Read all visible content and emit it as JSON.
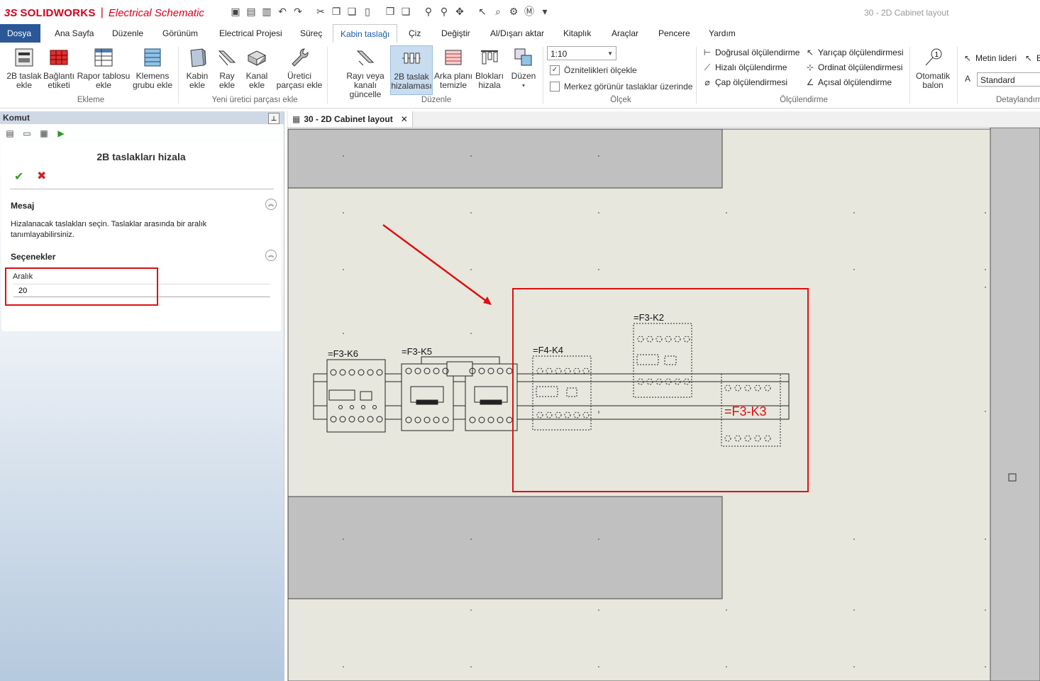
{
  "app": {
    "logo_mark": "3S",
    "logo_brand": "SOLIDWORKS",
    "product": "Electrical Schematic",
    "document_title": "30 - 2D Cabinet layout"
  },
  "menu": {
    "file": "Dosya",
    "tabs": [
      "Ana Sayfa",
      "Düzenle",
      "Görünüm",
      "Electrical Projesi",
      "Süreç",
      "Kabin taslağı",
      "Çiz",
      "Değiştir",
      "Al/Dışarı aktar",
      "Kitaplık",
      "Araçlar",
      "Pencere",
      "Yardım"
    ],
    "active": "Kabin taslağı"
  },
  "ribbon": {
    "ekleme": {
      "group": "Ekleme",
      "b1": [
        "2B taslak",
        "ekle"
      ],
      "b2": [
        "Bağlantı",
        "etiketi"
      ],
      "b3": [
        "Rapor tablosu",
        "ekle"
      ],
      "b4": [
        "Klemens",
        "grubu ekle"
      ]
    },
    "yeni": {
      "group": "Yeni üretici parçası ekle",
      "b1": [
        "Kabin",
        "ekle"
      ],
      "b2": [
        "Ray",
        "ekle"
      ],
      "b3": [
        "Kanal",
        "ekle"
      ],
      "b4": [
        "Üretici",
        "parçası ekle"
      ]
    },
    "duzenle": {
      "group": "Düzenle",
      "b1": [
        "Rayı veya",
        "kanalı güncelle"
      ],
      "b2": [
        "2B taslak",
        "hizalaması"
      ],
      "b3": [
        "Arka planı",
        "temizle"
      ],
      "b4": [
        "Blokları",
        "hizala"
      ],
      "b5": [
        "Düzen"
      ]
    },
    "olcek": {
      "group": "Ölçek",
      "scale": "1:10",
      "chk1": "Öznitelikleri ölçekle",
      "chk1_checked": "✓",
      "chk2": "Merkez görünür taslaklar üzerinde"
    },
    "olculendirme": {
      "group": "Ölçülendirme",
      "d1": "Doğrusal ölçülendirme",
      "d2": "Hizalı ölçülendirme",
      "d3": "Çap ölçülendirmesi",
      "d4": "Yarıçap ölçülendirmesi",
      "d5": "Ordinat ölçülendirmesi",
      "d6": "Açısal ölçülendirme"
    },
    "balon": [
      "Otomatik",
      "balon"
    ],
    "detay": {
      "group": "Detaylandırm",
      "metin": "Metin lideri",
      "b_cut": "B",
      "standard": "Standard"
    }
  },
  "panel": {
    "header": "Komut",
    "title": "2B taslakları hizala",
    "message_section": "Mesaj",
    "message": "Hizalanacak taslakları seçin. Taslaklar arasında bir aralık tanımlayabilirsiniz.",
    "options_section": "Seçenekler",
    "aralik_label": "Aralık",
    "aralik_value": "20"
  },
  "doc_tab": {
    "label": "30 - 2D Cabinet layout",
    "close": "✕"
  },
  "drawing": {
    "labels": [
      "=F3-K6",
      "=F3-K5",
      "=F4-K4",
      "=F3-K2",
      "=F3-K3"
    ]
  },
  "colors": {
    "accent": "#2b5797",
    "highlight": "#e01010",
    "canvas": "#e7e7de",
    "plate": "#c0c0c0"
  }
}
